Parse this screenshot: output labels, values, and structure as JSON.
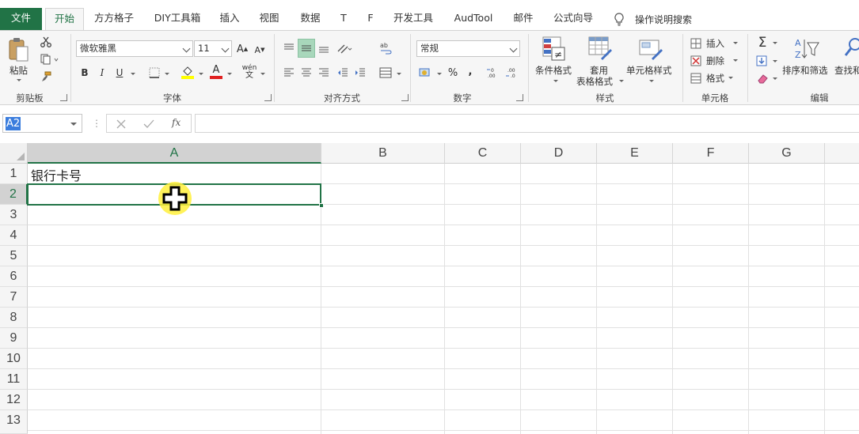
{
  "tabs": [
    {
      "id": "file",
      "label": "文件"
    },
    {
      "id": "home",
      "label": "开始"
    },
    {
      "id": "ffgz",
      "label": "方方格子"
    },
    {
      "id": "diy",
      "label": "DIY工具箱"
    },
    {
      "id": "insert",
      "label": "插入"
    },
    {
      "id": "view",
      "label": "视图"
    },
    {
      "id": "data",
      "label": "数据"
    },
    {
      "id": "t",
      "label": "T"
    },
    {
      "id": "f",
      "label": "F"
    },
    {
      "id": "dev",
      "label": "开发工具"
    },
    {
      "id": "audtool",
      "label": "AudTool"
    },
    {
      "id": "mail",
      "label": "邮件"
    },
    {
      "id": "formula",
      "label": "公式向导"
    }
  ],
  "tell_me": "操作说明搜索",
  "ribbon": {
    "clipboard": {
      "paste": "粘贴",
      "label": "剪贴板"
    },
    "font": {
      "name": "微软雅黑",
      "size": "11",
      "bold": "B",
      "italic": "I",
      "underline": "U",
      "grow": "A",
      "shrink": "A",
      "font_color": "A",
      "phonetic": "wén",
      "label": "字体"
    },
    "alignment": {
      "label": "对齐方式"
    },
    "number": {
      "format": "常规",
      "percent": "%",
      "comma": ",",
      "label": "数字"
    },
    "styles": {
      "conditional": "条件格式",
      "table_line1": "套用",
      "table_line2": "表格格式",
      "cell_styles": "单元格样式",
      "label": "样式"
    },
    "cells": {
      "insert": "插入",
      "delete": "删除",
      "format": "格式",
      "label": "单元格"
    },
    "editing": {
      "sort": "排序和筛选",
      "find": "查找和",
      "label": "编辑"
    }
  },
  "formula_bar": {
    "name_box": "A2",
    "fx": "fx",
    "content": ""
  },
  "grid": {
    "columns": [
      "A",
      "B",
      "C",
      "D",
      "E",
      "F",
      "G"
    ],
    "rows": [
      "1",
      "2",
      "3",
      "4",
      "5",
      "6",
      "7",
      "8",
      "9",
      "10",
      "11",
      "12",
      "13"
    ],
    "selected_cell": "A2",
    "cells": {
      "A1": "银行卡号"
    }
  },
  "colors": {
    "accent": "#217346",
    "selection_border": "#217346",
    "cursor_highlight": "#fff03c"
  }
}
